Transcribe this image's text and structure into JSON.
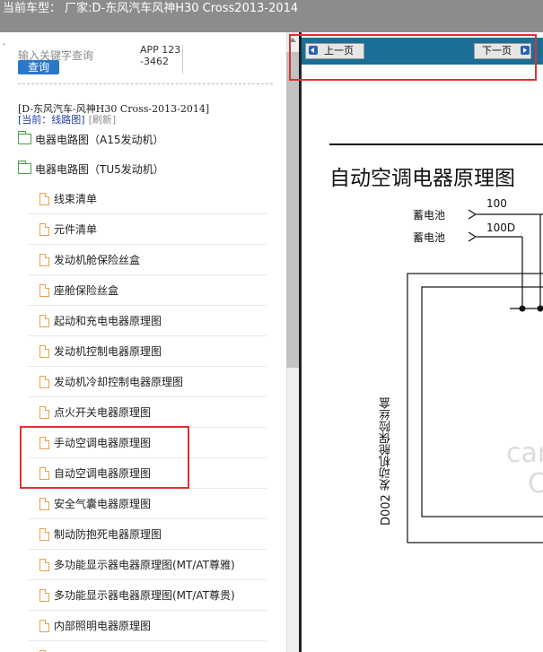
{
  "titlebar": {
    "text": "当前车型：  厂家:D-东风汽车风神H30 Cross2013-2014"
  },
  "left": {
    "dot": ".",
    "search_placeholder": "输入关键字查询",
    "search_button": "查询",
    "app_code": "APP 123-3462",
    "model_path": "[D-东风汽车-风神H30 Cross-2013-2014]",
    "current_label": "[当前：",
    "current_link": "线路图",
    "current_close": "]",
    "refresh": "[刷新]",
    "folders": [
      "电器电路图（A15发动机）",
      "电器电路图（TU5发动机）"
    ],
    "items": [
      "线束清单",
      "元件清单",
      "发动机舱保险丝盒",
      "座舱保险丝盒",
      "起动和充电电器原理图",
      "发动机控制电器原理图",
      "发动机冷却控制电器原理图",
      "点火开关电器原理图",
      "手动空调电器原理图",
      "自动空调电器原理图",
      "安全气囊电器原理图",
      "制动防抱死电器原理图",
      "多功能显示器电器原理图(MT/AT尊雅)",
      "多功能显示器电器原理图(MT/AT尊贵)",
      "内部照明电器原理图",
      ""
    ]
  },
  "viewer": {
    "prev_button": "上一页",
    "next_button": "下一页",
    "diagram_title": "自动空调电器原理图",
    "wires": [
      {
        "label": "蓄电池",
        "code": "100"
      },
      {
        "label": "蓄电池",
        "code": "100D"
      }
    ],
    "fuse_box_label": "D002 发动机舱保险丝盒",
    "watermark_1": "car",
    "watermark_2": "C"
  },
  "colors": {
    "titlebar_bg": "#8c8c8c",
    "search_button_bg": "#2b78c8",
    "navbar_bg": "#1b6e96",
    "highlight_red": "#e03030",
    "folder_green": "#46a046",
    "doc_orange": "#e8a24a"
  }
}
